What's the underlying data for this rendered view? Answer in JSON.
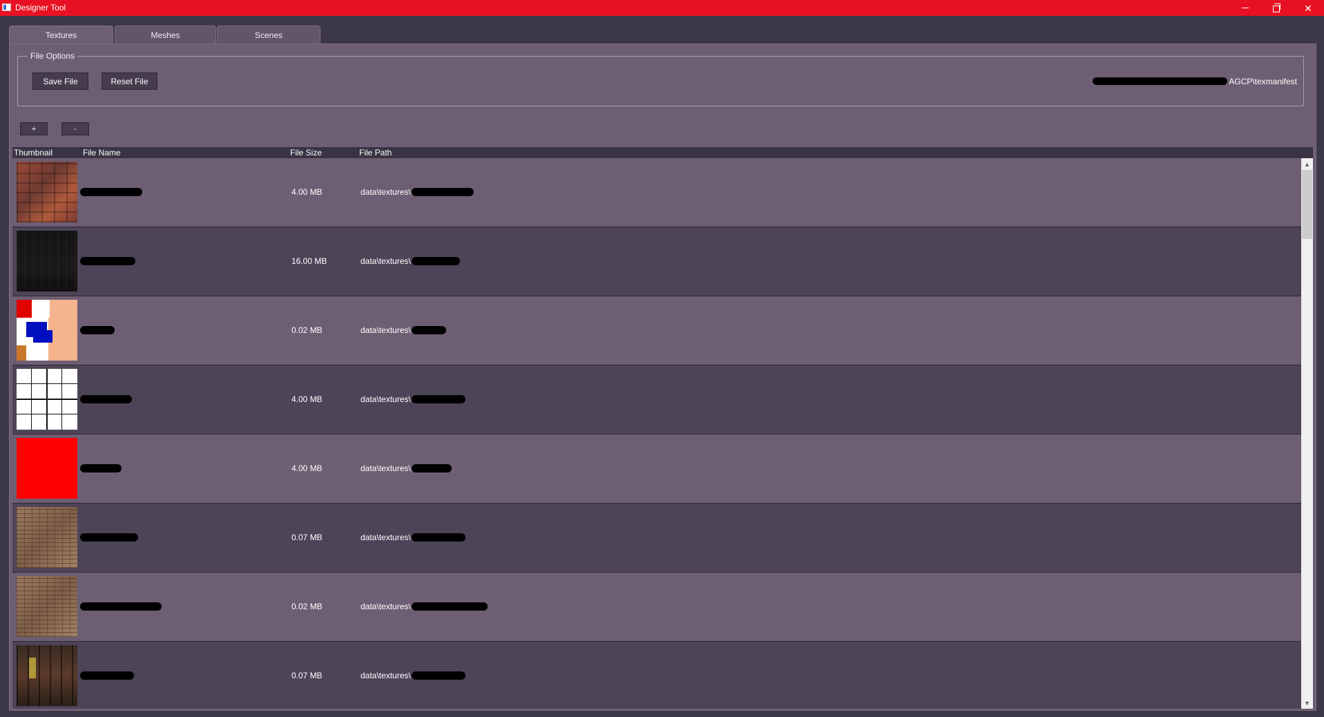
{
  "window": {
    "title": "Designer Tool"
  },
  "tabs": [
    {
      "label": "Textures",
      "active": true
    },
    {
      "label": "Meshes",
      "active": false
    },
    {
      "label": "Scenes",
      "active": false
    }
  ],
  "file_options": {
    "title": "File Options",
    "save_label": "Save File",
    "reset_label": "Reset File",
    "file_path_suffix": "AGCP\\texmanifest"
  },
  "list_buttons": {
    "add_label": "+",
    "remove_label": "-"
  },
  "table": {
    "headers": {
      "thumbnail": "Thumbnail",
      "file_name": "File Name",
      "file_size": "File Size",
      "file_path": "File Path"
    },
    "rows": [
      {
        "size": "4.00 MB",
        "path_prefix": "data\\textures\\",
        "thumbnail": "rust-metal-texture"
      },
      {
        "size": "16.00 MB",
        "path_prefix": "data\\textures\\",
        "thumbnail": "dark-texture"
      },
      {
        "size": "0.02 MB",
        "path_prefix": "data\\textures\\",
        "thumbnail": "skin-color-texture"
      },
      {
        "size": "4.00 MB",
        "path_prefix": "data\\textures\\",
        "thumbnail": "grid-texture"
      },
      {
        "size": "4.00 MB",
        "path_prefix": "data\\textures\\",
        "thumbnail": "red-texture"
      },
      {
        "size": "0.07 MB",
        "path_prefix": "data\\textures\\",
        "thumbnail": "brick-texture"
      },
      {
        "size": "0.02 MB",
        "path_prefix": "data\\textures\\",
        "thumbnail": "brick-texture"
      },
      {
        "size": "0.07 MB",
        "path_prefix": "data\\textures\\",
        "thumbnail": "dark-door-texture"
      }
    ]
  },
  "colors": {
    "titlebar": "#e81123",
    "panel": "#6e5e73",
    "row_alt": "#4e4458",
    "background": "#3d3848"
  }
}
